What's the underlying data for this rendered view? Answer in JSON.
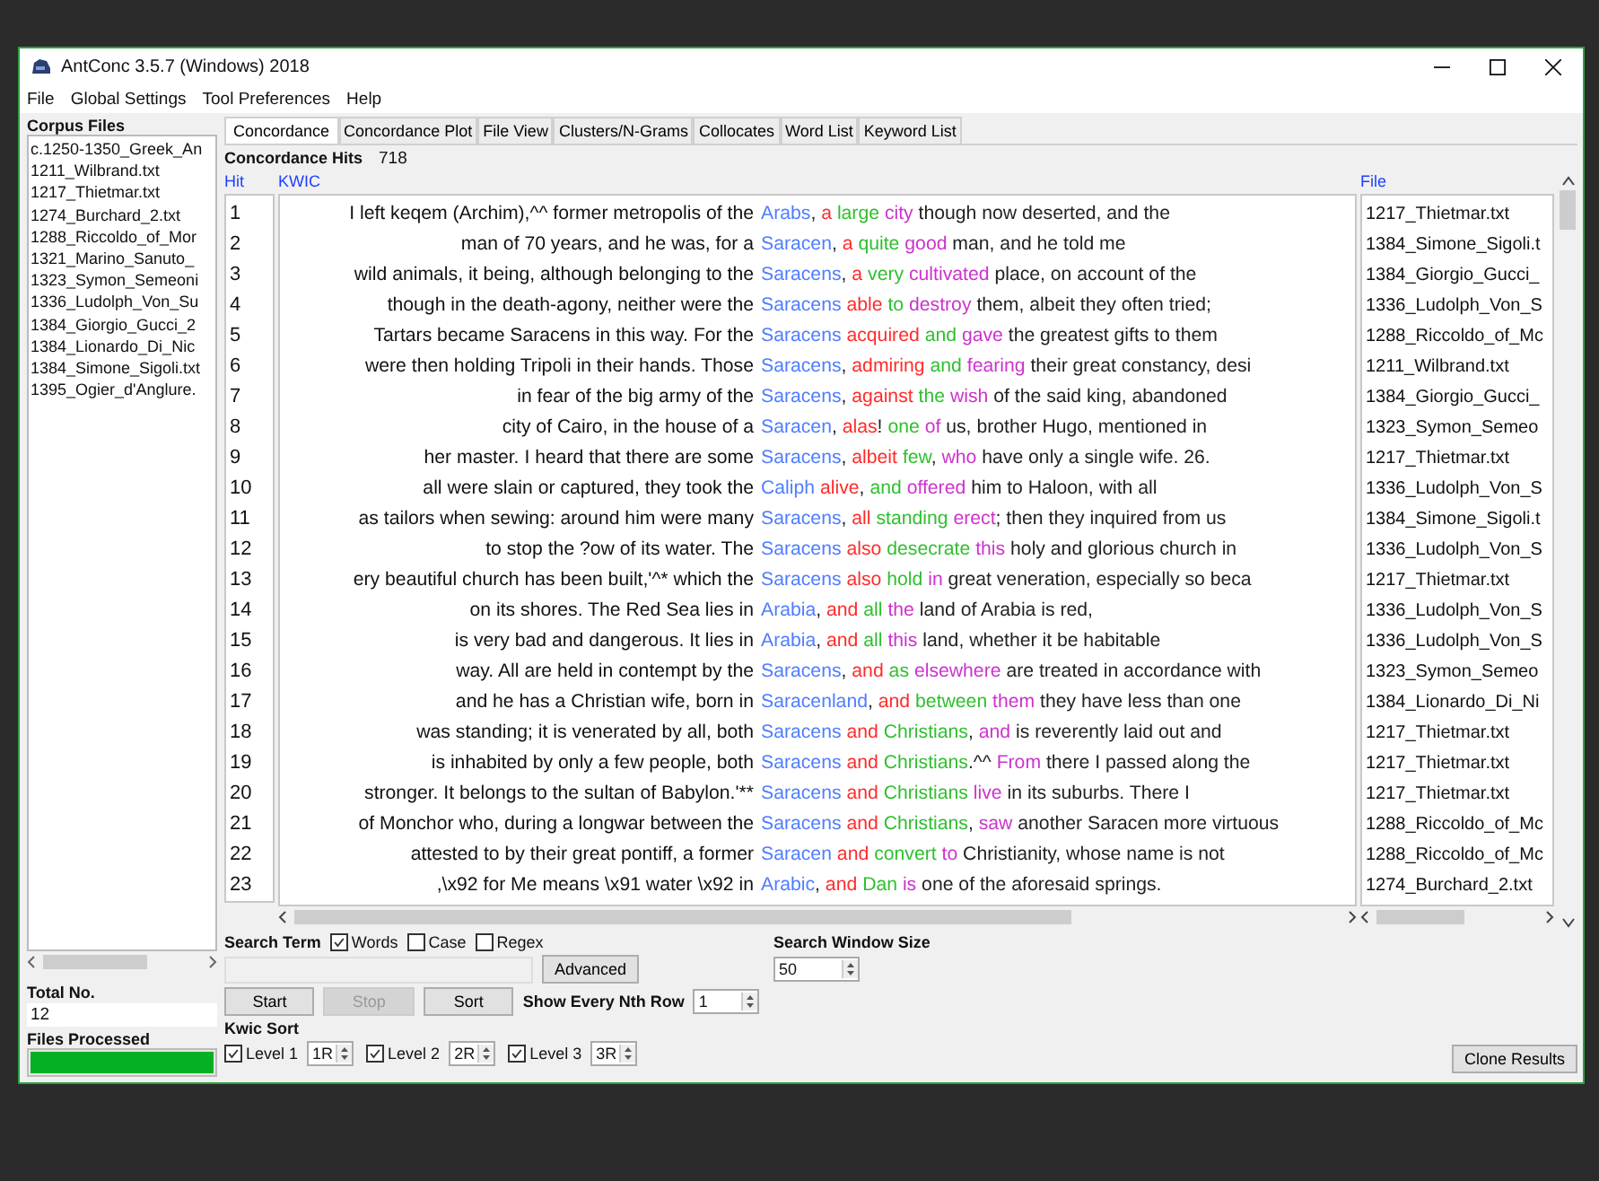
{
  "window": {
    "title": "AntConc 3.5.7 (Windows) 2018"
  },
  "menu": [
    "File",
    "Global Settings",
    "Tool Preferences",
    "Help"
  ],
  "corpus_files": {
    "title": "Corpus Files",
    "items": [
      "c.1250-1350_Greek_An",
      "1211_Wilbrand.txt",
      "1217_Thietmar.txt",
      "1274_Burchard_2.txt",
      "1288_Riccoldo_of_Mor",
      "1321_Marino_Sanuto_",
      "1323_Symon_Semeoni",
      "1336_Ludolph_Von_Su",
      "1384_Giorgio_Gucci_2",
      "1384_Lionardo_Di_Nic",
      "1384_Simone_Sigoli.txt",
      "1395_Ogier_d'Anglure."
    ]
  },
  "total": {
    "label": "Total No.",
    "value": "12"
  },
  "files_processed": {
    "label": "Files Processed",
    "level": 1
  },
  "tabs": [
    {
      "label": "Concordance",
      "selected": true
    },
    {
      "label": "Concordance Plot",
      "selected": false
    },
    {
      "label": "File View",
      "selected": false
    },
    {
      "label": "Clusters/N-Grams",
      "selected": false
    },
    {
      "label": "Collocates",
      "selected": false
    },
    {
      "label": "Word List",
      "selected": false
    },
    {
      "label": "Keyword List",
      "selected": false
    }
  ],
  "hits": {
    "label": "Concordance Hits",
    "value": "718"
  },
  "columns": {
    "hit": "Hit",
    "kwic": "KWIC",
    "file": "File"
  },
  "rows": [
    {
      "hit": "1",
      "left": "I left keqem (Archim),^^ former metropolis of the",
      "right": [
        {
          "text": "Arabs",
          "kind": "keyword",
          "after": ", "
        },
        {
          "text": "a",
          "kind": "sort1"
        },
        {
          "text": "large",
          "kind": "sort2"
        },
        {
          "text": "city",
          "kind": "sort3"
        },
        {
          "text": " though now deserted, and the",
          "kind": "plain"
        }
      ],
      "file": "1217_Thietmar.txt"
    },
    {
      "hit": "2",
      "left": "man of 70 years, and he was, for a",
      "right": [
        {
          "text": "Saracen",
          "kind": "keyword",
          "after": ", "
        },
        {
          "text": "a",
          "kind": "sort1"
        },
        {
          "text": "quite",
          "kind": "sort2"
        },
        {
          "text": "good",
          "kind": "sort3"
        },
        {
          "text": " man, and he told me",
          "kind": "plain"
        }
      ],
      "file": "1384_Simone_Sigoli.t"
    },
    {
      "hit": "3",
      "left": "wild animals, it being, although belonging to the",
      "right": [
        {
          "text": "Saracens",
          "kind": "keyword",
          "after": ", "
        },
        {
          "text": "a",
          "kind": "sort1"
        },
        {
          "text": "very",
          "kind": "sort2"
        },
        {
          "text": "cultivated",
          "kind": "sort3"
        },
        {
          "text": " place, on account of the",
          "kind": "plain"
        }
      ],
      "file": "1384_Giorgio_Gucci_"
    },
    {
      "hit": "4",
      "left": "though in the death-agony, neither were the",
      "right": [
        {
          "text": "Saracens",
          "kind": "keyword"
        },
        {
          "text": "able",
          "kind": "sort1"
        },
        {
          "text": "to",
          "kind": "sort2"
        },
        {
          "text": "destroy",
          "kind": "sort3"
        },
        {
          "text": " them, albeit they often tried;",
          "kind": "plain"
        }
      ],
      "file": "1336_Ludolph_Von_S"
    },
    {
      "hit": "5",
      "left": "Tartars became Saracens in this way. For the",
      "right": [
        {
          "text": "Saracens",
          "kind": "keyword"
        },
        {
          "text": "acquired",
          "kind": "sort1"
        },
        {
          "text": "and",
          "kind": "sort2"
        },
        {
          "text": "gave",
          "kind": "sort3"
        },
        {
          "text": " the greatest gifts to them",
          "kind": "plain"
        }
      ],
      "file": "1288_Riccoldo_of_Mc"
    },
    {
      "hit": "6",
      "left": "were then holding Tripoli in their hands. Those",
      "right": [
        {
          "text": "Saracens",
          "kind": "keyword",
          "after": ", "
        },
        {
          "text": "admiring",
          "kind": "sort1"
        },
        {
          "text": "and",
          "kind": "sort2"
        },
        {
          "text": "fearing",
          "kind": "sort3"
        },
        {
          "text": " their great constancy, desi",
          "kind": "plain"
        }
      ],
      "file": "1211_Wilbrand.txt"
    },
    {
      "hit": "7",
      "left": "in fear of the big army of the",
      "right": [
        {
          "text": "Saracens",
          "kind": "keyword",
          "after": ", "
        },
        {
          "text": "against",
          "kind": "sort1"
        },
        {
          "text": "the",
          "kind": "sort2"
        },
        {
          "text": "wish",
          "kind": "sort3"
        },
        {
          "text": " of the said king, abandoned",
          "kind": "plain"
        }
      ],
      "file": "1384_Giorgio_Gucci_"
    },
    {
      "hit": "8",
      "left": "city of Cairo, in the house of a",
      "right": [
        {
          "text": "Saracen",
          "kind": "keyword",
          "after": ", "
        },
        {
          "text": "alas",
          "kind": "sort1",
          "after": "! "
        },
        {
          "text": "one",
          "kind": "sort2"
        },
        {
          "text": "of",
          "kind": "sort3"
        },
        {
          "text": " us, brother Hugo, mentioned in",
          "kind": "plain"
        }
      ],
      "file": "1323_Symon_Semeo"
    },
    {
      "hit": "9",
      "left": "her master. I heard that there are some",
      "right": [
        {
          "text": "Saracens",
          "kind": "keyword",
          "after": ", "
        },
        {
          "text": "albeit",
          "kind": "sort1"
        },
        {
          "text": "few",
          "kind": "sort2",
          "after": ", "
        },
        {
          "text": "who",
          "kind": "sort3"
        },
        {
          "text": " have only a single wife. 26.",
          "kind": "plain"
        }
      ],
      "file": "1217_Thietmar.txt"
    },
    {
      "hit": "10",
      "left": "all were slain or captured, they took the",
      "right": [
        {
          "text": "Caliph",
          "kind": "keyword"
        },
        {
          "text": "alive",
          "kind": "sort1",
          "after": ", "
        },
        {
          "text": "and",
          "kind": "sort2"
        },
        {
          "text": "offered",
          "kind": "sort3"
        },
        {
          "text": " him to Haloon, with all",
          "kind": "plain"
        }
      ],
      "file": "1336_Ludolph_Von_S"
    },
    {
      "hit": "11",
      "left": "as tailors when sewing: around him were many",
      "right": [
        {
          "text": "Saracens",
          "kind": "keyword",
          "after": ", "
        },
        {
          "text": "all",
          "kind": "sort1"
        },
        {
          "text": "standing",
          "kind": "sort2"
        },
        {
          "text": "erect",
          "kind": "sort3"
        },
        {
          "text": "; then they inquired from us",
          "kind": "plain"
        }
      ],
      "file": "1384_Simone_Sigoli.t"
    },
    {
      "hit": "12",
      "left": "to stop the ?ow of its water. The",
      "right": [
        {
          "text": "Saracens",
          "kind": "keyword"
        },
        {
          "text": "also",
          "kind": "sort1"
        },
        {
          "text": "desecrate",
          "kind": "sort2"
        },
        {
          "text": "this",
          "kind": "sort3"
        },
        {
          "text": " holy and glorious church in",
          "kind": "plain"
        }
      ],
      "file": "1336_Ludolph_Von_S"
    },
    {
      "hit": "13",
      "left": "ery beautiful church has been built,'^* which the",
      "right": [
        {
          "text": "Saracens",
          "kind": "keyword"
        },
        {
          "text": "also",
          "kind": "sort1"
        },
        {
          "text": "hold",
          "kind": "sort2"
        },
        {
          "text": "in",
          "kind": "sort3"
        },
        {
          "text": " great veneration, especially so beca",
          "kind": "plain"
        }
      ],
      "file": "1217_Thietmar.txt"
    },
    {
      "hit": "14",
      "left": "on its shores. The Red Sea lies in",
      "right": [
        {
          "text": "Arabia",
          "kind": "keyword",
          "after": ", "
        },
        {
          "text": "and",
          "kind": "sort1"
        },
        {
          "text": "all",
          "kind": "sort2"
        },
        {
          "text": "the",
          "kind": "sort3"
        },
        {
          "text": " land of Arabia is red,",
          "kind": "plain"
        }
      ],
      "file": "1336_Ludolph_Von_S"
    },
    {
      "hit": "15",
      "left": "is very bad and dangerous. It lies in",
      "right": [
        {
          "text": "Arabia",
          "kind": "keyword",
          "after": ", "
        },
        {
          "text": "and",
          "kind": "sort1"
        },
        {
          "text": "all",
          "kind": "sort2"
        },
        {
          "text": "this",
          "kind": "sort3"
        },
        {
          "text": " land, whether it be habitable",
          "kind": "plain"
        }
      ],
      "file": "1336_Ludolph_Von_S"
    },
    {
      "hit": "16",
      "left": "way. All are held in contempt by the",
      "right": [
        {
          "text": "Saracens",
          "kind": "keyword",
          "after": ", "
        },
        {
          "text": "and",
          "kind": "sort1"
        },
        {
          "text": "as",
          "kind": "sort2"
        },
        {
          "text": "elsewhere",
          "kind": "sort3"
        },
        {
          "text": " are treated in accordance with",
          "kind": "plain"
        }
      ],
      "file": "1323_Symon_Semeo"
    },
    {
      "hit": "17",
      "left": "and he has a Christian wife, born in",
      "right": [
        {
          "text": "Saracenland",
          "kind": "keyword",
          "after": ", "
        },
        {
          "text": "and",
          "kind": "sort1"
        },
        {
          "text": "between",
          "kind": "sort2"
        },
        {
          "text": "them",
          "kind": "sort3"
        },
        {
          "text": " they have less than one",
          "kind": "plain"
        }
      ],
      "file": "1384_Lionardo_Di_Ni"
    },
    {
      "hit": "18",
      "left": "was standing; it is venerated by all, both",
      "right": [
        {
          "text": "Saracens",
          "kind": "keyword"
        },
        {
          "text": "and",
          "kind": "sort1"
        },
        {
          "text": "Christians",
          "kind": "sort2",
          "after": ", "
        },
        {
          "text": "and",
          "kind": "sort3"
        },
        {
          "text": " is reverently laid out and",
          "kind": "plain"
        }
      ],
      "file": "1217_Thietmar.txt"
    },
    {
      "hit": "19",
      "left": "is inhabited by only a few people, both",
      "right": [
        {
          "text": "Saracens",
          "kind": "keyword"
        },
        {
          "text": "and",
          "kind": "sort1"
        },
        {
          "text": "Christians",
          "kind": "sort2",
          "after": ".^^ "
        },
        {
          "text": "From",
          "kind": "sort3"
        },
        {
          "text": " there I passed along the",
          "kind": "plain"
        }
      ],
      "file": "1217_Thietmar.txt"
    },
    {
      "hit": "20",
      "left": "stronger. It belongs to the sultan of Babylon.'**",
      "right": [
        {
          "text": "Saracens",
          "kind": "keyword"
        },
        {
          "text": "and",
          "kind": "sort1"
        },
        {
          "text": "Christians",
          "kind": "sort2"
        },
        {
          "text": "live",
          "kind": "sort3"
        },
        {
          "text": " in its suburbs. There I",
          "kind": "plain"
        }
      ],
      "file": "1217_Thietmar.txt"
    },
    {
      "hit": "21",
      "left": "of Monchor who, during a longwar between the",
      "right": [
        {
          "text": "Saracens",
          "kind": "keyword"
        },
        {
          "text": "and",
          "kind": "sort1"
        },
        {
          "text": "Christians",
          "kind": "sort2",
          "after": ", "
        },
        {
          "text": "saw",
          "kind": "sort3"
        },
        {
          "text": " another Saracen more virtuous",
          "kind": "plain"
        }
      ],
      "file": "1288_Riccoldo_of_Mc"
    },
    {
      "hit": "22",
      "left": "attested to by their great pontiff, a former",
      "right": [
        {
          "text": "Saracen",
          "kind": "keyword"
        },
        {
          "text": "and",
          "kind": "sort1"
        },
        {
          "text": "convert",
          "kind": "sort2"
        },
        {
          "text": "to",
          "kind": "sort3"
        },
        {
          "text": " Christianity, whose name is not",
          "kind": "plain"
        }
      ],
      "file": "1288_Riccoldo_of_Mc"
    },
    {
      "hit": "23",
      "left": ",\\x92 for Me means \\x91 water \\x92 in",
      "right": [
        {
          "text": "Arabic",
          "kind": "keyword",
          "after": ", "
        },
        {
          "text": "and",
          "kind": "sort1"
        },
        {
          "text": "Dan",
          "kind": "sort2"
        },
        {
          "text": "is",
          "kind": "sort3"
        },
        {
          "text": " one of the aforesaid springs.",
          "kind": "plain"
        }
      ],
      "file": "1274_Burchard_2.txt"
    }
  ],
  "search": {
    "label": "Search Term",
    "options": [
      {
        "label": "Words",
        "checked": true
      },
      {
        "label": "Case",
        "checked": false
      },
      {
        "label": "Regex",
        "checked": false
      }
    ],
    "advanced": "Advanced"
  },
  "buttons": [
    {
      "label": "Start",
      "disabled": false
    },
    {
      "label": "Stop",
      "disabled": true
    },
    {
      "label": "Sort",
      "disabled": false
    }
  ],
  "nth_row": {
    "label": "Show Every Nth Row",
    "value": "1"
  },
  "window_size": {
    "label": "Search Window Size",
    "value": "50"
  },
  "kwic_sort": {
    "label": "Kwic Sort",
    "levels": [
      {
        "label": "Level 1",
        "checked": true,
        "value": "1R"
      },
      {
        "label": "Level 2",
        "checked": true,
        "value": "2R"
      },
      {
        "label": "Level 3",
        "checked": true,
        "value": "3R"
      }
    ]
  },
  "clone": "Clone Results"
}
